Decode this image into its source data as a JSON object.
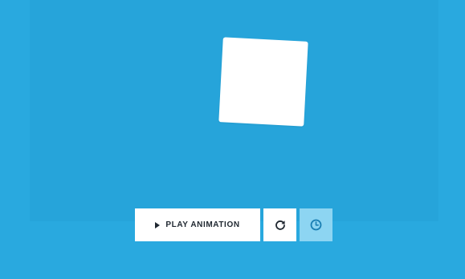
{
  "controls": {
    "play_label": "PLAY ANIMATION",
    "icons": {
      "play": "play-icon",
      "restart": "refresh-icon",
      "timer": "clock-icon"
    }
  },
  "colors": {
    "page_background": "#29a9df",
    "stage_background": "#26a4da",
    "square": "#ffffff",
    "button_background": "#ffffff",
    "button_active_background": "#8dd5f2",
    "text": "#1f2730",
    "clock_icon": "#1a7fb3"
  }
}
